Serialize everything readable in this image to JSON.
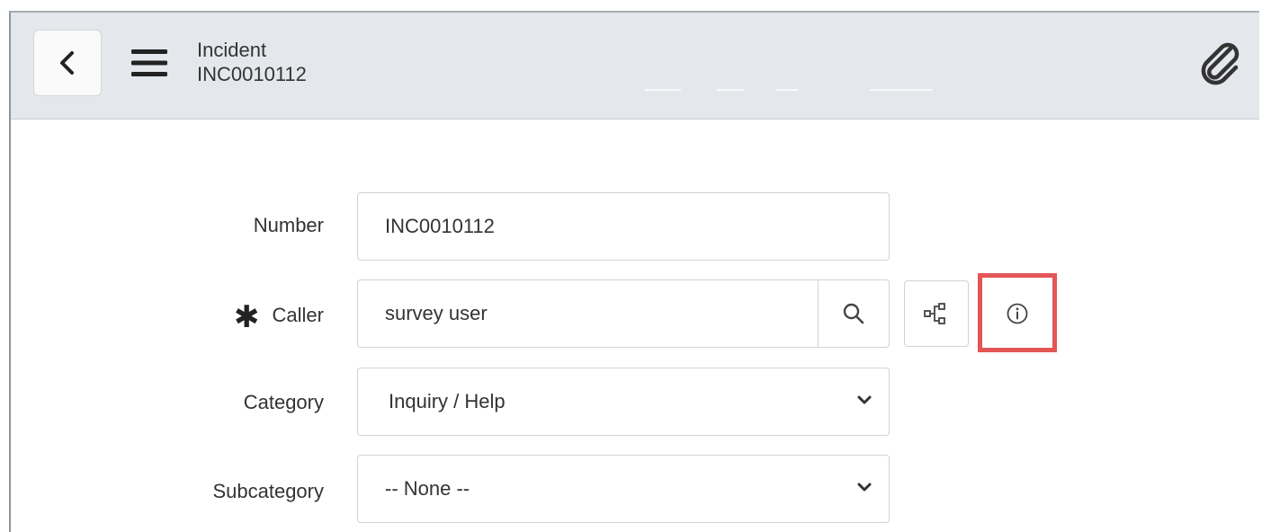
{
  "header": {
    "record_type": "Incident",
    "record_number": "INC0010112",
    "icons": {
      "back": "chevron-left-icon",
      "menu": "hamburger-menu-icon",
      "attachment": "paperclip-icon"
    }
  },
  "form": {
    "number": {
      "label": "Number",
      "value": "INC0010112"
    },
    "caller": {
      "required_marker": "✱",
      "label": "Caller",
      "value": "survey user",
      "icons": [
        "search-icon",
        "dependency-map-icon",
        "info-icon"
      ]
    },
    "category": {
      "label": "Category",
      "value": "Inquiry / Help"
    },
    "subcategory": {
      "label": "Subcategory",
      "value": "-- None --"
    }
  },
  "colors": {
    "header_bg": "#e4e7eb",
    "highlight": "#e45555",
    "field_border": "#cfd3d7"
  }
}
